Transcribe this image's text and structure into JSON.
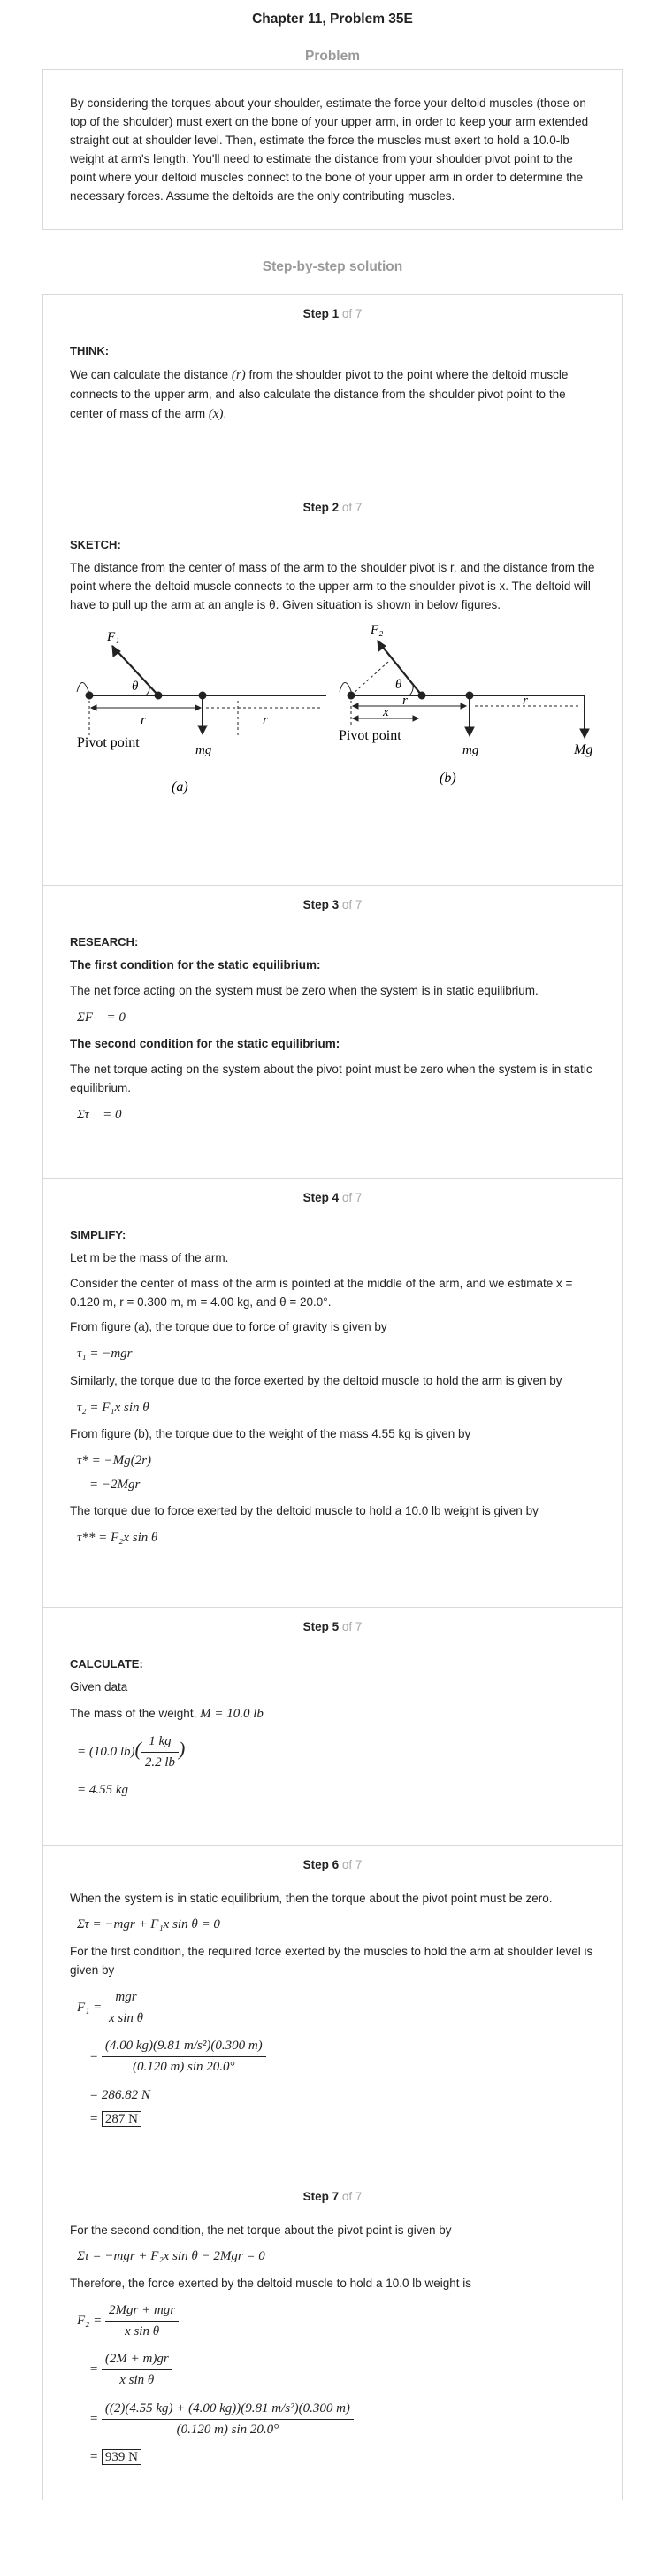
{
  "page_title": "Chapter 11, Problem 35E",
  "problem_heading": "Problem",
  "problem_text": "By considering the torques about your shoulder, estimate the force your deltoid muscles (those on top of the shoulder) must exert on the bone of your upper arm, in order to keep your arm extended straight out at shoulder level. Then, estimate the force the muscles must exert to hold a 10.0-lb weight at arm's length. You'll need to estimate the distance from your shoulder pivot point to the point where your deltoid muscles connect to the bone of your upper arm in order to determine the necessary forces. Assume the deltoids are the only contributing muscles.",
  "solution_heading": "Step-by-step solution",
  "step_word": "Step",
  "of_total": "of 7",
  "steps": {
    "s1": {
      "num": "1",
      "label": "THINK:",
      "text_a": "We can calculate the distance ",
      "r": "(r)",
      "text_b": " from the shoulder pivot to the point where the deltoid muscle connects to the upper arm, and also calculate the distance from the shoulder pivot point to the center of mass of the arm ",
      "x": "(x)",
      "text_c": "."
    },
    "s2": {
      "num": "2",
      "label": "SKETCH:",
      "text": "The distance from the center of mass of the arm to the shoulder pivot is r, and the distance from the point where the deltoid muscle connects to the upper arm to the shoulder pivot is x. The deltoid will have to pull up the arm at an angle is θ. Given situation is shown in below figures.",
      "fig": {
        "f1": "F₁",
        "f2": "F₂",
        "theta": "θ",
        "r": "r",
        "x": "x",
        "mg": "mg",
        "Mg": "Mg",
        "pivot": "Pivot point",
        "a": "(a)",
        "b": "(b)"
      }
    },
    "s3": {
      "num": "3",
      "label": "RESEARCH:",
      "h1": "The first condition for the static equilibrium:",
      "t1": "The net force acting on the system must be zero when the system is in static equilibrium.",
      "eq1": "ΣF⃗ = 0",
      "h2": "The second condition for the static equilibrium:",
      "t2": "The net torque acting on the system about the pivot point must be zero when the system is in static equilibrium.",
      "eq2": "Στ⃗ = 0"
    },
    "s4": {
      "num": "4",
      "label": "SIMPLIFY:",
      "t1": "Let  m  be the mass of the arm.",
      "t2": "Consider the center of mass of the arm is pointed at the middle of the arm, and we estimate x = 0.120 m, r = 0.300 m, m = 4.00 kg, and θ = 20.0°.",
      "t3": "From figure (a), the torque due to force of gravity is given by",
      "eq1": "τ₁ = −mgr",
      "t4": "Similarly, the torque due to the force exerted by the deltoid muscle to hold the arm is given by",
      "eq2": "τ₂ = F₁x sin θ",
      "t5": "From figure (b), the torque due to the weight of the mass  4.55 kg  is given by",
      "eq3": "τ* = −Mg(2r)",
      "eq4": "= −2Mgr",
      "t6": "The torque due to force exerted by the deltoid muscle to hold a  10.0 lb weight is given by",
      "eq5": "τ** = F₂x sin θ"
    },
    "s5": {
      "num": "5",
      "label": "CALCULATE:",
      "t1": "Given data",
      "t2": "The mass of the weight,",
      "eq0": "M = 10.0 lb",
      "eq1a": "= (10.0 lb)",
      "eq1n": "1 kg",
      "eq1d": "2.2 lb",
      "eq2": "= 4.55 kg"
    },
    "s6": {
      "num": "6",
      "t1": "When the system is in static equilibrium, then the torque about the pivot point must be zero.",
      "eq1": "Στ = −mgr + F₁x sin θ = 0",
      "t2": "For the first condition, the required force exerted by the muscles to hold the arm at shoulder level is given by",
      "f1": "F₁ =",
      "n1": "mgr",
      "d1": "x sin θ",
      "n2": "(4.00 kg)(9.81 m/s²)(0.300 m)",
      "d2": "(0.120 m) sin 20.0°",
      "eq3": "= 286.82 N",
      "ans": "287 N"
    },
    "s7": {
      "num": "7",
      "t1": "For the second condition, the net torque about the pivot point is given by",
      "eq1": "Στ = −mgr + F₂x sin θ − 2Mgr = 0",
      "t2": "Therefore, the force exerted by the deltoid muscle to hold a  10.0 lb weight is",
      "f2": "F₂ =",
      "n1": "2Mgr + mgr",
      "d1": "x sin θ",
      "n2": "(2M + m)gr",
      "d2": "x sin θ",
      "n3": "((2)(4.55 kg) + (4.00 kg))(9.81 m/s²)(0.300 m)",
      "d3": "(0.120 m) sin 20.0°",
      "ans": "939 N"
    }
  }
}
